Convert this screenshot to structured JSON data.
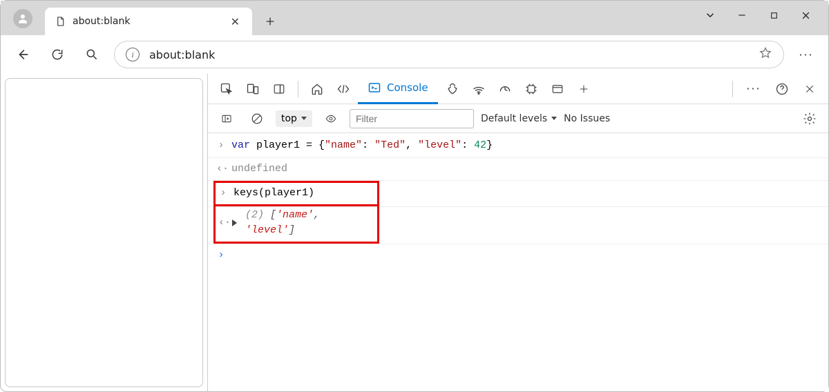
{
  "browser": {
    "tab_title": "about:blank",
    "url": "about:blank"
  },
  "devtools": {
    "active_tab": "Console",
    "filterbar": {
      "context": "top",
      "filter_placeholder": "Filter",
      "levels_label": "Default levels",
      "issues_label": "No Issues"
    },
    "console_lines": {
      "line1_input_raw": "var player1 = {\"name\": \"Ted\", \"level\": 42}",
      "line1_kw": "var",
      "line1_ident": " player1 = {",
      "line1_prop1": "\"name\"",
      "line1_sep1": ": ",
      "line1_val1": "\"Ted\"",
      "line1_sep2": ", ",
      "line1_prop2": "\"level\"",
      "line1_sep3": ": ",
      "line1_val2": "42",
      "line1_close": "}",
      "line2_output": "undefined",
      "line3_input": "keys(player1)",
      "line4_count": "(2) ",
      "line4_open": "[",
      "line4_v1": "'name'",
      "line4_sep": ", ",
      "line4_v2": "'level'",
      "line4_close": "]"
    }
  }
}
